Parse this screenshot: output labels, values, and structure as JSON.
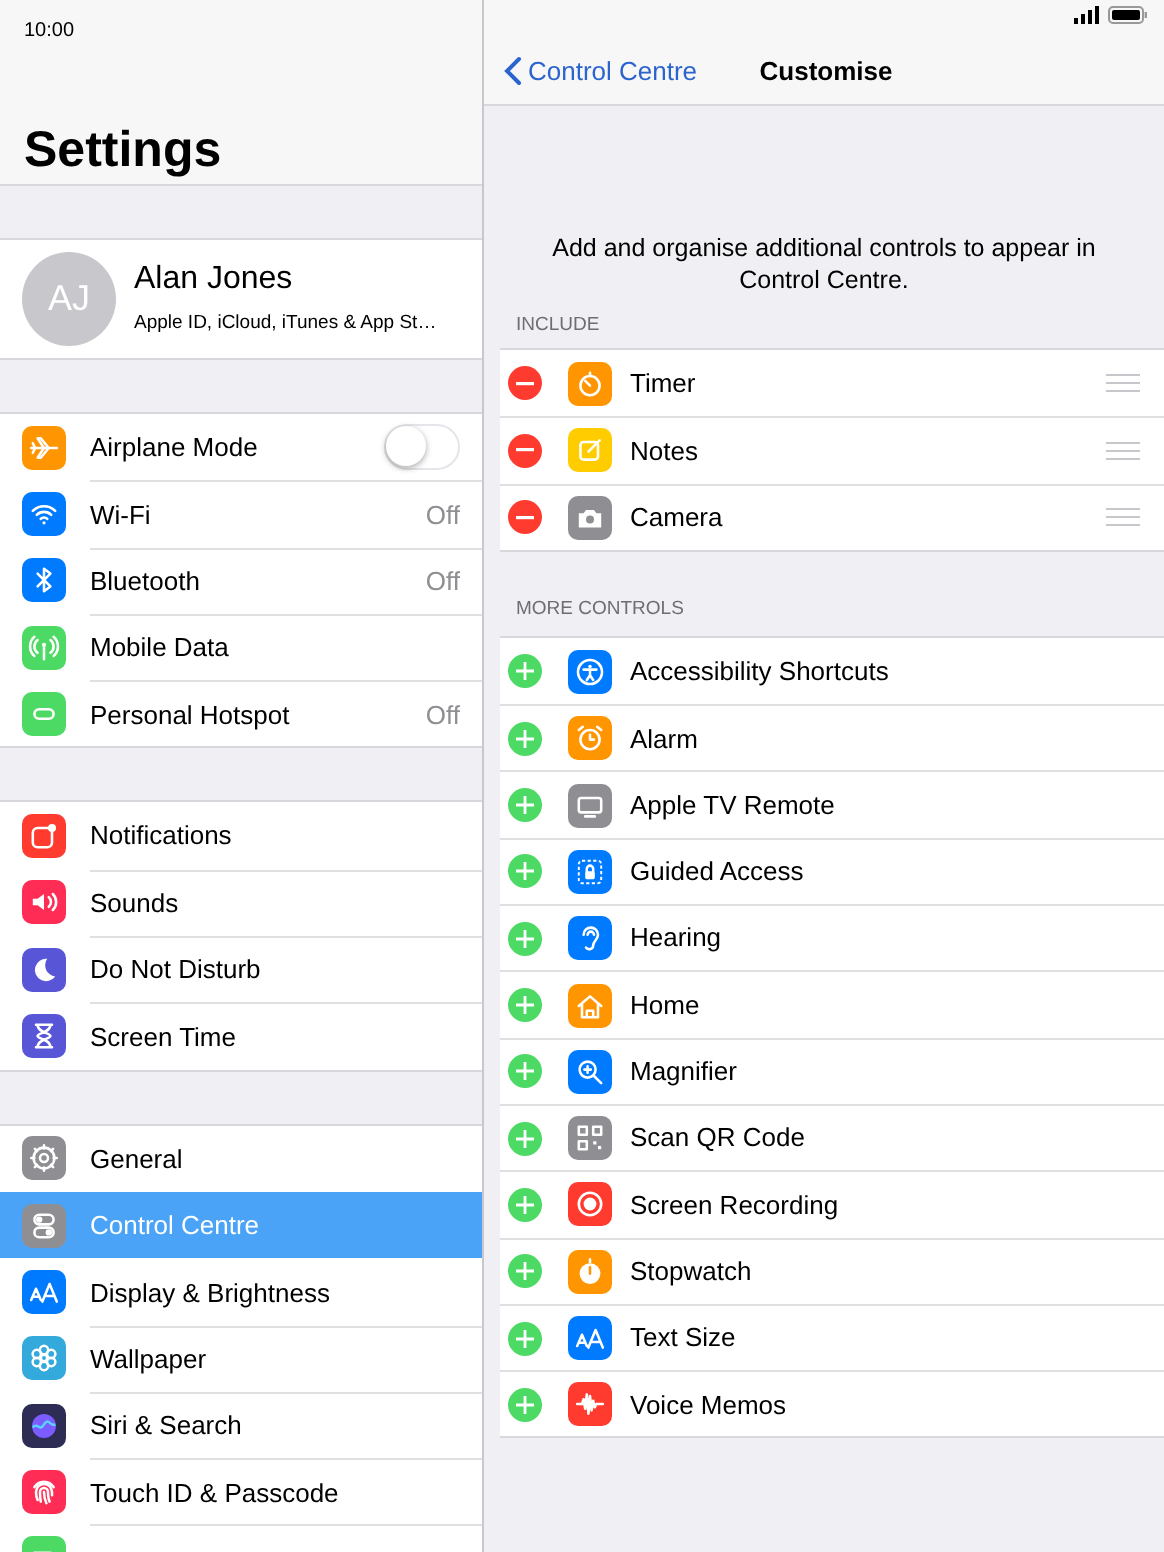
{
  "status_bar": {
    "time": "10:00"
  },
  "sidebar": {
    "title": "Settings",
    "profile": {
      "initials": "AJ",
      "name": "Alan Jones",
      "subtitle": "Apple ID, iCloud, iTunes & App St…"
    },
    "groups": [
      {
        "items": [
          {
            "label": "Airplane Mode",
            "kind": "toggle",
            "on": false,
            "color": "#ff9500",
            "selected": false
          },
          {
            "label": "Wi-Fi",
            "kind": "value",
            "value": "Off",
            "color": "#007aff",
            "selected": false
          },
          {
            "label": "Bluetooth",
            "kind": "value",
            "value": "Off",
            "color": "#007aff",
            "selected": false
          },
          {
            "label": "Mobile Data",
            "kind": "plain",
            "color": "#4cd964",
            "selected": false
          },
          {
            "label": "Personal Hotspot",
            "kind": "value",
            "value": "Off",
            "color": "#4cd964",
            "selected": false
          }
        ]
      },
      {
        "items": [
          {
            "label": "Notifications",
            "kind": "plain",
            "color": "#ff3b30",
            "selected": false
          },
          {
            "label": "Sounds",
            "kind": "plain",
            "color": "#ff2d55",
            "selected": false
          },
          {
            "label": "Do Not Disturb",
            "kind": "plain",
            "color": "#5856d6",
            "selected": false
          },
          {
            "label": "Screen Time",
            "kind": "plain",
            "color": "#5856d6",
            "selected": false
          }
        ]
      },
      {
        "items": [
          {
            "label": "General",
            "kind": "plain",
            "color": "#8e8e93",
            "selected": false
          },
          {
            "label": "Control Centre",
            "kind": "plain",
            "color": "#8e8e93",
            "selected": true
          },
          {
            "label": "Display & Brightness",
            "kind": "plain",
            "color": "#007aff",
            "selected": false
          },
          {
            "label": "Wallpaper",
            "kind": "plain",
            "color": "#34aadc",
            "selected": false
          },
          {
            "label": "Siri & Search",
            "kind": "plain",
            "color": "#2c2c54",
            "selected": false
          },
          {
            "label": "Touch ID & Passcode",
            "kind": "plain",
            "color": "#ff2d55",
            "selected": false
          },
          {
            "kind": "plain",
            "color": "#4cd964",
            "selected": false
          }
        ]
      }
    ]
  },
  "detail": {
    "back": "Control Centre",
    "title": "Customise",
    "description": "Add and organise additional controls to appear in Control Centre.",
    "sections": [
      {
        "header": "INCLUDE",
        "items": [
          {
            "label": "Timer",
            "kind": "remove",
            "color": "#ff9500"
          },
          {
            "label": "Notes",
            "kind": "remove",
            "color": "#ffcc00"
          },
          {
            "label": "Camera",
            "kind": "remove",
            "color": "#8e8e93"
          }
        ]
      },
      {
        "header": "MORE CONTROLS",
        "items": [
          {
            "label": "Accessibility Shortcuts",
            "kind": "add",
            "color": "#007aff"
          },
          {
            "label": "Alarm",
            "kind": "add",
            "color": "#ff9500"
          },
          {
            "label": "Apple TV Remote",
            "kind": "add",
            "color": "#8e8e93"
          },
          {
            "label": "Guided Access",
            "kind": "add",
            "color": "#007aff"
          },
          {
            "label": "Hearing",
            "kind": "add",
            "color": "#007aff"
          },
          {
            "label": "Home",
            "kind": "add",
            "color": "#ff9500"
          },
          {
            "label": "Magnifier",
            "kind": "add",
            "color": "#007aff"
          },
          {
            "label": "Scan QR Code",
            "kind": "add",
            "color": "#8e8e93"
          },
          {
            "label": "Screen Recording",
            "kind": "add",
            "color": "#ff3b30"
          },
          {
            "label": "Stopwatch",
            "kind": "add",
            "color": "#ff9500"
          },
          {
            "label": "Text Size",
            "kind": "add",
            "color": "#007aff"
          },
          {
            "label": "Voice Memos",
            "kind": "add",
            "color": "#ff3b30"
          }
        ]
      }
    ]
  }
}
